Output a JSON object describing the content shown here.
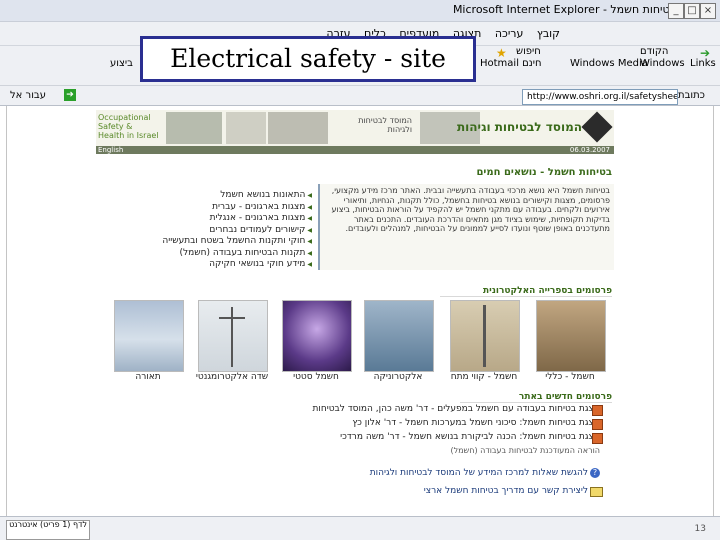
{
  "window": {
    "title": "בטיחות חשמל - Microsoft Internet Explorer",
    "min": "_",
    "max": "□",
    "close": "×"
  },
  "menu": {
    "items": [
      "קובץ",
      "עריכה",
      "תצוגה",
      "מועדפים",
      "כלים",
      "עזרה"
    ]
  },
  "toolbar": {
    "back_label": "הקודם",
    "search_label": "חיפוש",
    "favorites_label": "מועדפים",
    "links_label": "Links",
    "windows_label": "Windows",
    "media_label": "Windows Media",
    "hotmail_label": "Hotmail חינם",
    "left_label": "ביצוע"
  },
  "address": {
    "label": "כתובת",
    "url": "http://www.oshri.org.il/safetysheet.htm",
    "go_label": "עבור אל"
  },
  "slide_title": "Electrical safety - site",
  "banner": {
    "left_text": "Occupational Safety & Health in Israel",
    "mid_text": "המוסד לבטיחות ולגיהות",
    "org_name": "המוסד לבטיחות וגיהות",
    "english_link": "English",
    "date": "06.03.2007"
  },
  "section_title": "בטיחות חשמל - נושאים חמים",
  "links": [
    "התאונות בנושא חשמל",
    "מצגות בארגונים - עברית",
    "מצגות בארגונים - אנגלית",
    "קישורים לעמודים נבחרים",
    "חוקי ותקנות החשמל בשטח ובתעשייה",
    "תקנות הבטיחות בעבודה (חשמל)",
    "מידע חוקי בנושאי חקיקה"
  ],
  "paragraph": "בטיחות חשמל היא נושא מרכזי בעבודה בתעשייה ובבית. האתר מרכז מידע מקצועי, פרסומים, מצגות וקישורים בנושא בטיחות בחשמל, כולל תקנות, הנחיות, ותיאורי אירועים ולקחים. בעבודה עם מתקני חשמל יש להקפיד על הוראות הבטיחות, ביצוע בדיקות תקופתיות, שימוש בציוד מגן מתאים והדרכת העובדים. התכנים באתר מתעדכנים באופן שוטף ונועדו לסייע לממונים על הבטיחות, למנהלים ולעובדים.",
  "electronic_header": "פרסומים בספרייה האלקטרונית",
  "tiles": [
    {
      "caption": "תאורה"
    },
    {
      "caption": "שדה אלקטרומגנטי"
    },
    {
      "caption": "חשמל סטטי"
    },
    {
      "caption": "אלקטרוניקה"
    },
    {
      "caption": "חשמל - קווי מתח"
    },
    {
      "caption": "חשמל - כללי"
    }
  ],
  "recent_header": "פרסומים חדשים באתר",
  "publications": [
    "מצגת בטיחות בעבודה עם חשמל במפעלים - דר' משה כהן, המוסד לבטיחות",
    "מצגת בטיחות חשמל: סיכוני חשמל במערכות חשמל - דר' אלון כץ",
    "מצגת בטיחות חשמל: הכנה לביקורת בנושא חשמל - דר' משה מרדכי",
    "הוראה המעודכנת לבטיחות בעבודה (חשמל)"
  ],
  "qa": [
    "להגשת שאלות למרכז המידע של המוסד לבטיחות ולגיהות",
    "ליצירת קשר עם מדריך בטיחות חשמל ארצי"
  ],
  "status": {
    "left_text": "לדף (1 פריט) אינטרנט",
    "page_number": "13"
  }
}
